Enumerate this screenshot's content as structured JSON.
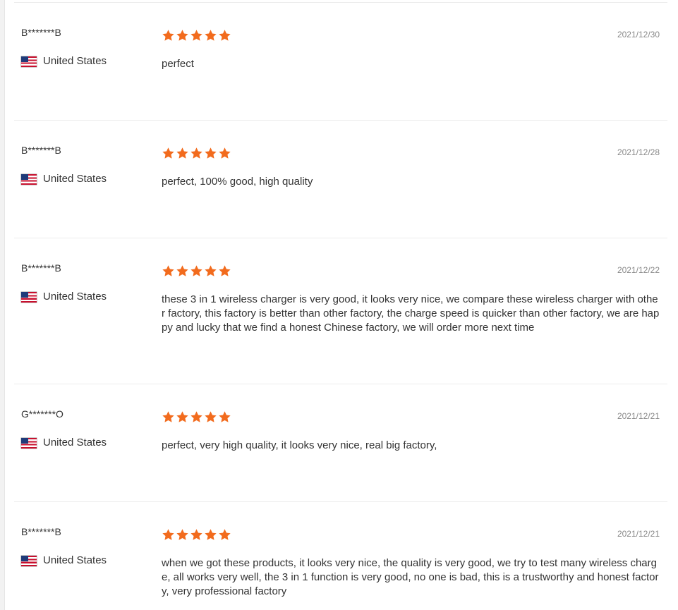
{
  "colors": {
    "star": "#f26b1d",
    "text": "#333333",
    "date": "#888888",
    "divider": "#ececec"
  },
  "reviews": [
    {
      "name": "B*******B",
      "country": "United States",
      "flag_icon": "us-flag-icon",
      "rating": 5,
      "date": "2021/12/30",
      "text": "perfect"
    },
    {
      "name": "B*******B",
      "country": "United States",
      "flag_icon": "us-flag-icon",
      "rating": 5,
      "date": "2021/12/28",
      "text": "perfect, 100% good, high quality"
    },
    {
      "name": "B*******B",
      "country": "United States",
      "flag_icon": "us-flag-icon",
      "rating": 5,
      "date": "2021/12/22",
      "text": "these 3 in 1 wireless charger is very good, it looks very nice, we compare these wireless charger with other factory, this factory is better than other factory, the charge speed is quicker than other factory, we are happy and lucky that we find a honest Chinese factory, we will order more next time"
    },
    {
      "name": "G*******O",
      "country": "United States",
      "flag_icon": "us-flag-icon",
      "rating": 5,
      "date": "2021/12/21",
      "text": "perfect, very high quality, it looks very nice, real big factory,"
    },
    {
      "name": "B*******B",
      "country": "United States",
      "flag_icon": "us-flag-icon",
      "rating": 5,
      "date": "2021/12/21",
      "text": "when we got these products, it looks very nice, the quality is very good, we try to test many wireless charge, all works very well, the 3 in 1 function is very good, no one is bad, this is a trustworthy and honest factory, very professional factory"
    }
  ]
}
